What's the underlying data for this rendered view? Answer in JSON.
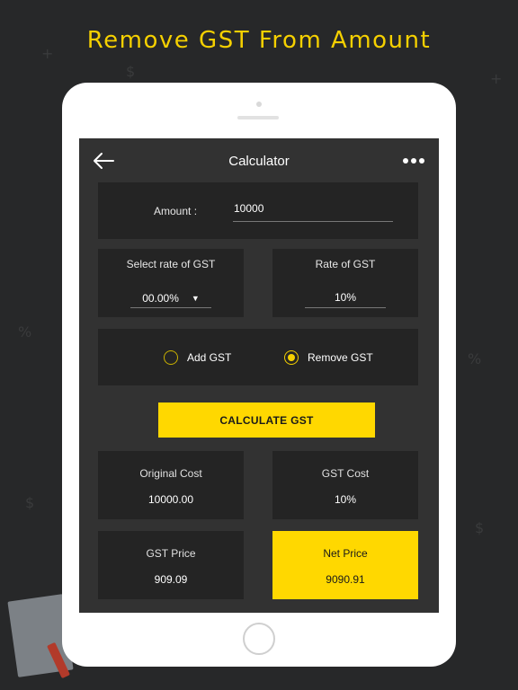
{
  "headline": "Remove GST From Amount",
  "colors": {
    "accent": "#ffd800",
    "background": "#272829",
    "card": "#242424",
    "screen": "#323232"
  },
  "nav": {
    "title": "Calculator",
    "back_icon": "arrow-left-icon",
    "more_icon": "more-horizontal-icon"
  },
  "amount": {
    "label": "Amount :",
    "value": "10000"
  },
  "rate_select": {
    "caption": "Select rate of GST",
    "value": "00.00%"
  },
  "rate_value": {
    "caption": "Rate of GST",
    "value": "10%"
  },
  "mode": {
    "add_label": "Add GST",
    "remove_label": "Remove GST",
    "selected": "remove"
  },
  "calculate_label": "CALCULATE GST",
  "results": {
    "original_cost": {
      "label": "Original Cost",
      "value": "10000.00"
    },
    "gst_cost": {
      "label": "GST Cost",
      "value": "10%"
    },
    "gst_price": {
      "label": "GST Price",
      "value": "909.09"
    },
    "net_price": {
      "label": "Net Price",
      "value": "9090.91"
    }
  }
}
